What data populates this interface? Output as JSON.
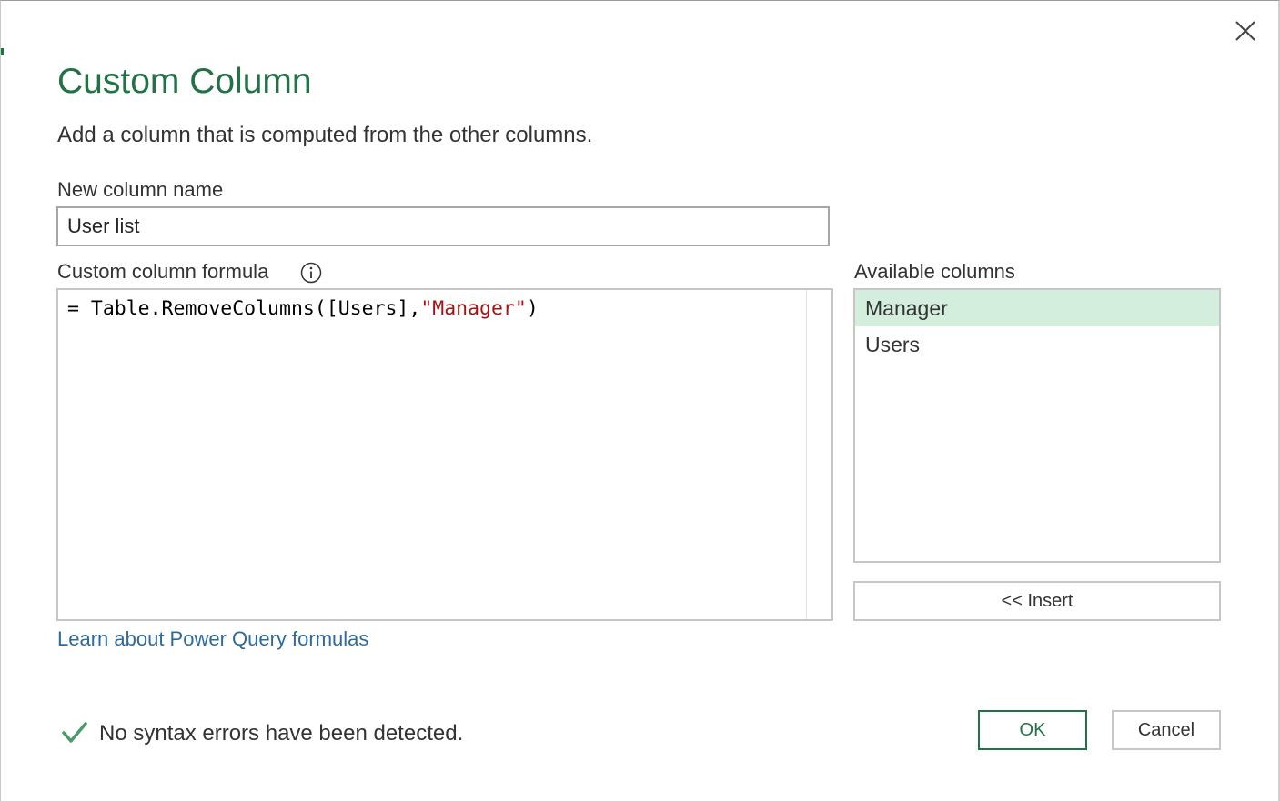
{
  "dialog": {
    "title": "Custom Column",
    "subtitle": "Add a column that is computed from the other columns.",
    "close_icon": "close-icon"
  },
  "name_field": {
    "label": "New column name",
    "value": "User list"
  },
  "formula": {
    "label": "Custom column formula",
    "info_icon": "info-icon",
    "prefix": "= Table.RemoveColumns([Users],",
    "string_literal": "\"Manager\"",
    "suffix": ")"
  },
  "available_columns": {
    "label": "Available columns",
    "items": [
      {
        "label": "Manager",
        "selected": true
      },
      {
        "label": "Users",
        "selected": false
      }
    ],
    "insert_label": "<< Insert"
  },
  "learn_link": "Learn about Power Query formulas",
  "status": {
    "icon": "checkmark-icon",
    "text": "No syntax errors have been detected."
  },
  "buttons": {
    "ok": "OK",
    "cancel": "Cancel"
  },
  "colors": {
    "accent": "#217346",
    "selection": "#d3eedd",
    "link": "#2e6a9d",
    "string_literal": "#a31515"
  }
}
